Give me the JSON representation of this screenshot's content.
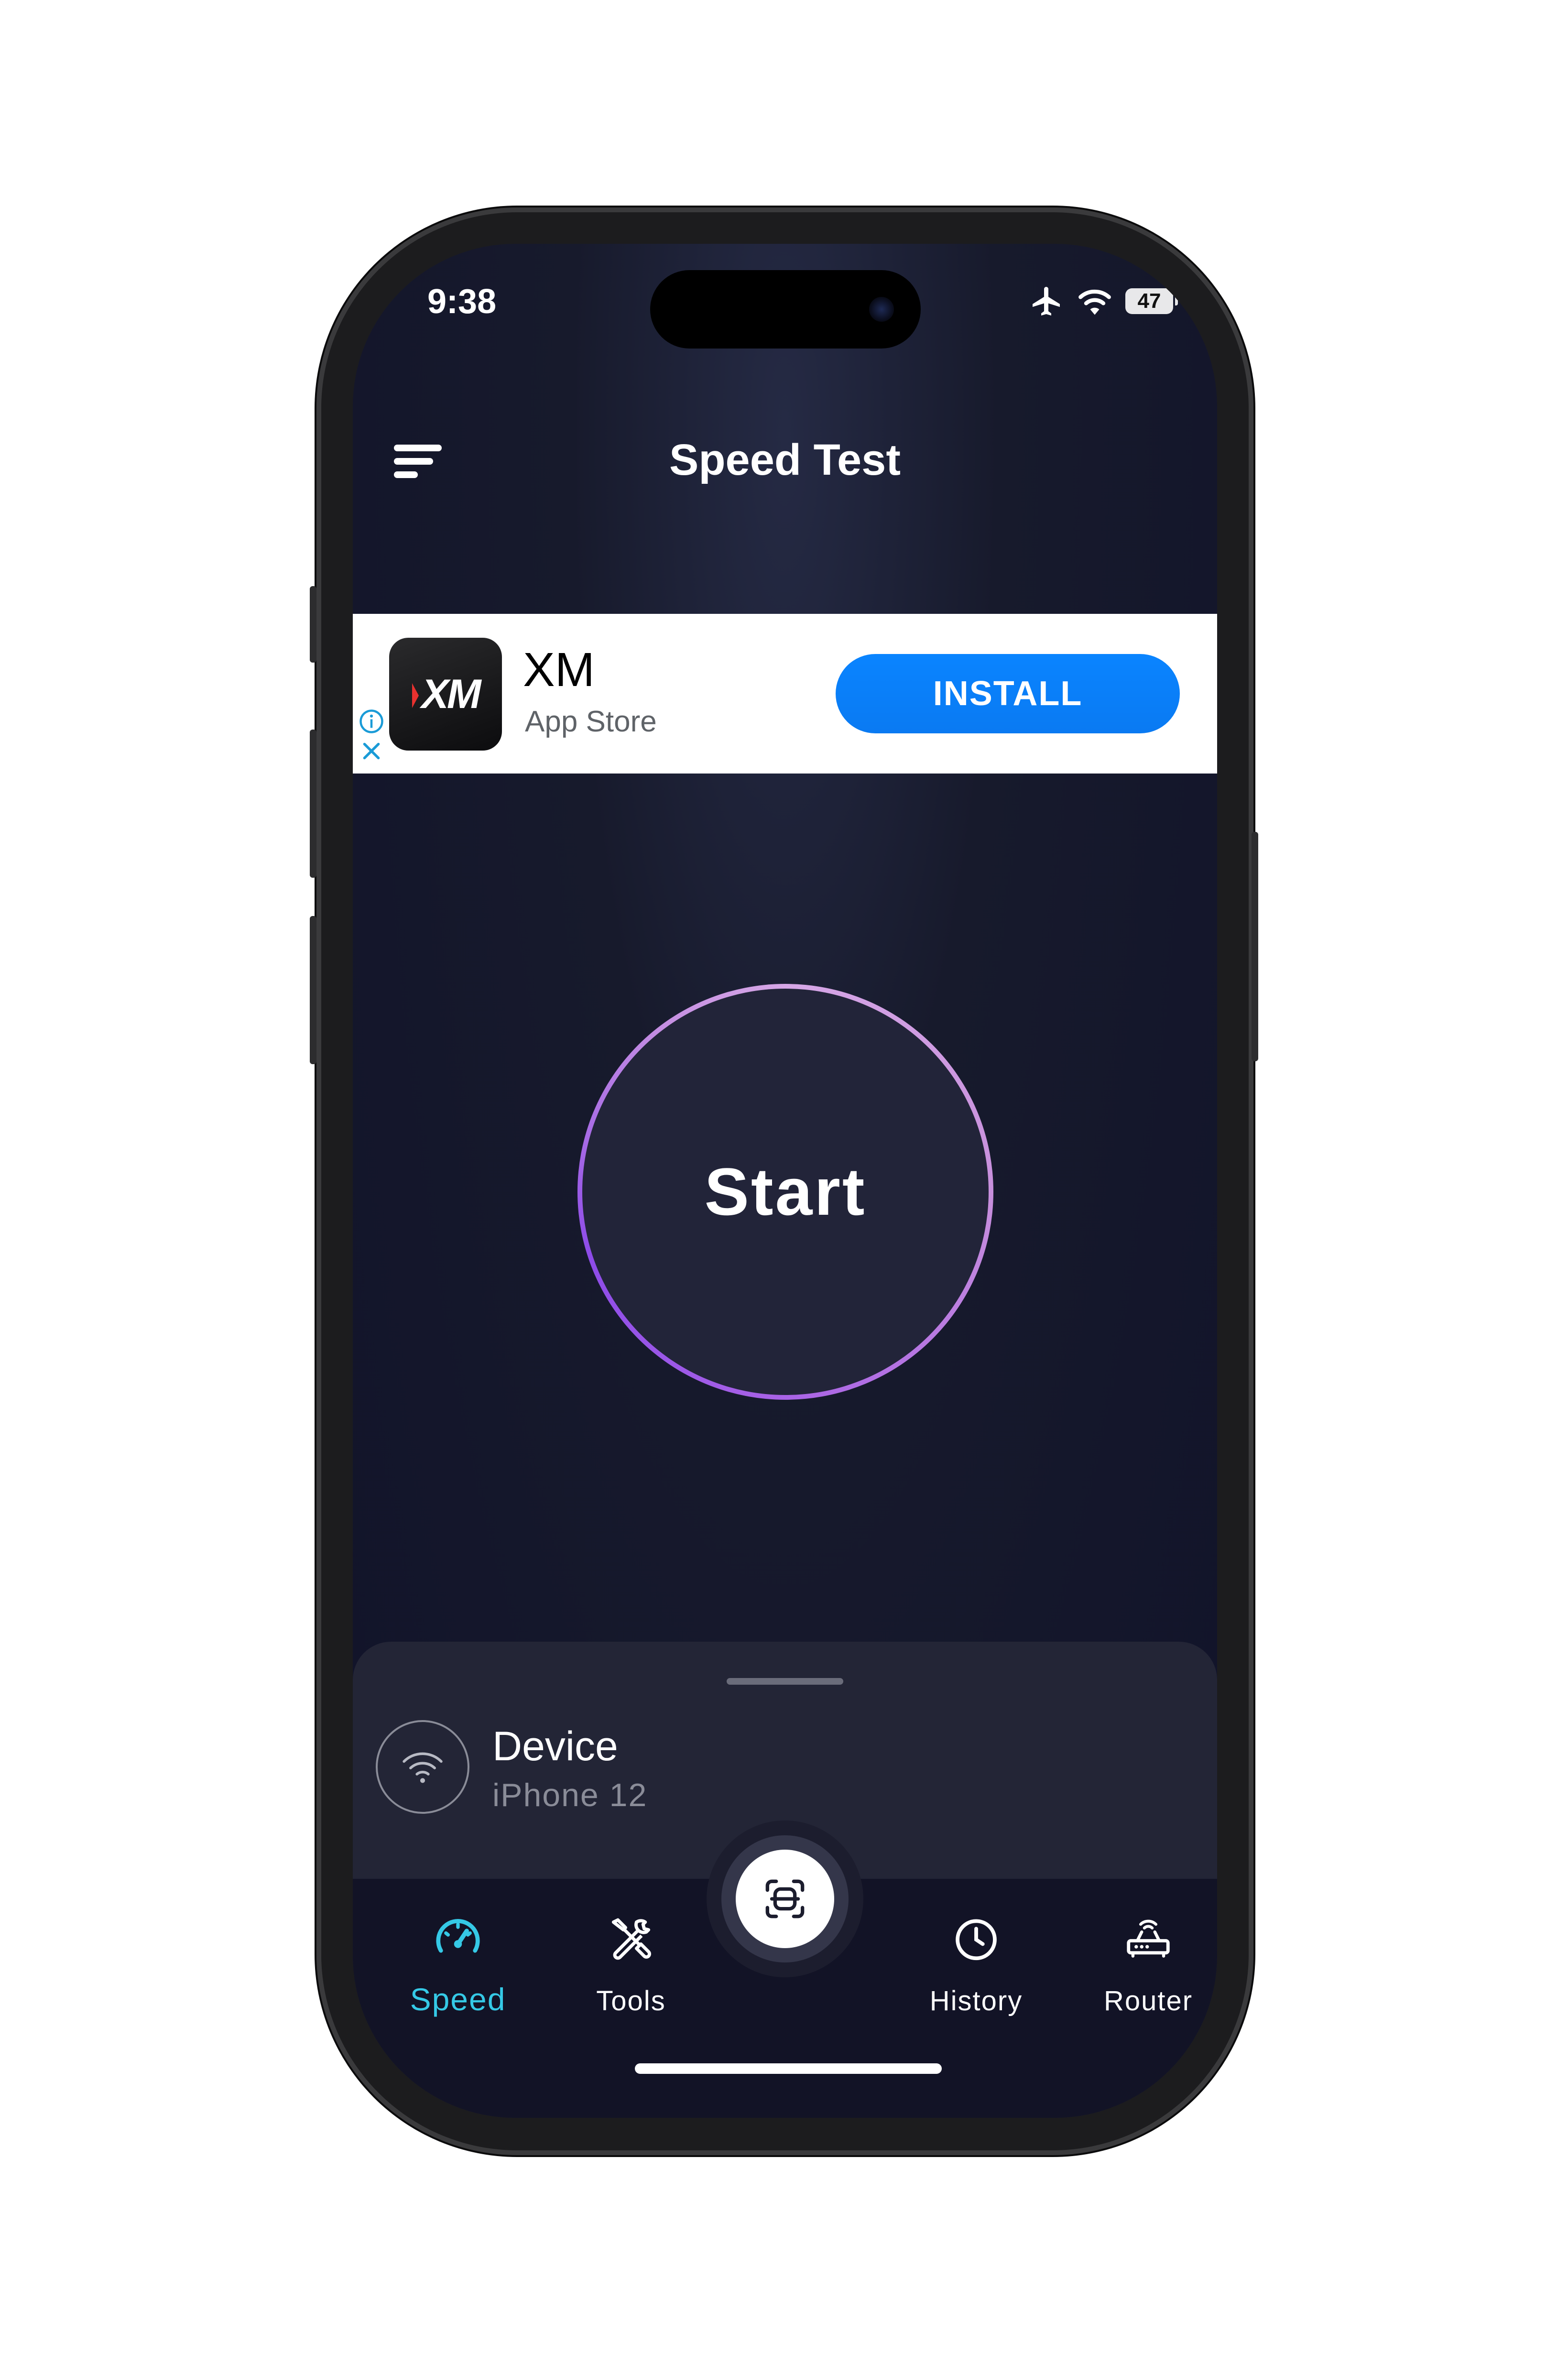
{
  "status_bar": {
    "time": "9:38",
    "battery": "47"
  },
  "header": {
    "title": "Speed Test"
  },
  "ad": {
    "app_name": "XM",
    "logo_text": "XM",
    "source": "App Store",
    "cta": "INSTALL",
    "cta_color": "#0a84ff"
  },
  "main": {
    "start_label": "Start"
  },
  "device_card": {
    "label": "Device",
    "value": "iPhone 12"
  },
  "tabbar": {
    "tabs": [
      {
        "label": "Speed",
        "icon": "speedometer-icon",
        "active": true
      },
      {
        "label": "Tools",
        "icon": "tools-icon",
        "active": false
      },
      {
        "label": "History",
        "icon": "clock-icon",
        "active": false
      },
      {
        "label": "Router",
        "icon": "router-icon",
        "active": false
      }
    ],
    "center_button_icon": "scan-icon",
    "active_color": "#35c9e6"
  }
}
